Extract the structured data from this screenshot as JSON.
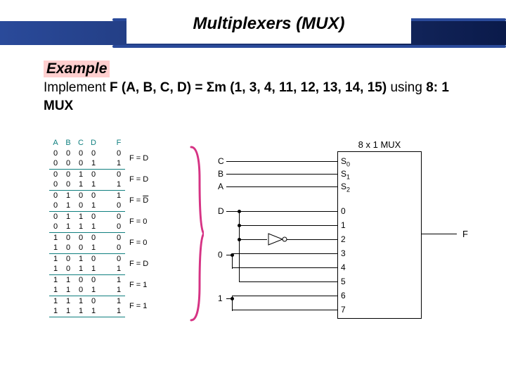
{
  "title": "Multiplexers (MUX)",
  "example_label": "Example",
  "statement_prefix": "Implement ",
  "statement_func": "F (A, B, C, D) = Σm (1, 3, 4, 11, 12, 13, 14, 15)",
  "statement_using": " using ",
  "statement_mux": "8: 1 MUX",
  "tt_headers": [
    "A",
    "B",
    "C",
    "D",
    "F"
  ],
  "tt_rows": [
    [
      "0",
      "0",
      "0",
      "0",
      "0"
    ],
    [
      "0",
      "0",
      "0",
      "1",
      "1"
    ],
    [
      "0",
      "0",
      "1",
      "0",
      "0"
    ],
    [
      "0",
      "0",
      "1",
      "1",
      "1"
    ],
    [
      "0",
      "1",
      "0",
      "0",
      "1"
    ],
    [
      "0",
      "1",
      "0",
      "1",
      "0"
    ],
    [
      "0",
      "1",
      "1",
      "0",
      "0"
    ],
    [
      "0",
      "1",
      "1",
      "1",
      "0"
    ],
    [
      "1",
      "0",
      "0",
      "0",
      "0"
    ],
    [
      "1",
      "0",
      "0",
      "1",
      "0"
    ],
    [
      "1",
      "0",
      "1",
      "0",
      "0"
    ],
    [
      "1",
      "0",
      "1",
      "1",
      "1"
    ],
    [
      "1",
      "1",
      "0",
      "0",
      "1"
    ],
    [
      "1",
      "1",
      "0",
      "1",
      "1"
    ],
    [
      "1",
      "1",
      "1",
      "0",
      "1"
    ],
    [
      "1",
      "1",
      "1",
      "1",
      "1"
    ]
  ],
  "tt_pair_labels": [
    "F = D",
    "F = D",
    "F = D̄",
    "F = 0",
    "F = 0",
    "F = D",
    "F = 1",
    "F = 1"
  ],
  "mux_title": "8 x 1 MUX",
  "sel_inputs": [
    "C",
    "B",
    "A"
  ],
  "sel_pins": [
    "S",
    "S",
    "S"
  ],
  "sel_sub": [
    "0",
    "1",
    "2"
  ],
  "data_inputs_left": {
    "d": "D",
    "zero": "0",
    "one": "1"
  },
  "data_pins": [
    "0",
    "1",
    "2",
    "3",
    "4",
    "5",
    "6",
    "7"
  ],
  "out_label": "F",
  "chart_data": {
    "type": "table",
    "title": "Truth table for F(A,B,C,D) = Σm(1,3,4,11,12,13,14,15)",
    "columns": [
      "A",
      "B",
      "C",
      "D",
      "F"
    ],
    "rows": [
      [
        0,
        0,
        0,
        0,
        0
      ],
      [
        0,
        0,
        0,
        1,
        1
      ],
      [
        0,
        0,
        1,
        0,
        0
      ],
      [
        0,
        0,
        1,
        1,
        1
      ],
      [
        0,
        1,
        0,
        0,
        1
      ],
      [
        0,
        1,
        0,
        1,
        0
      ],
      [
        0,
        1,
        1,
        0,
        0
      ],
      [
        0,
        1,
        1,
        1,
        0
      ],
      [
        1,
        0,
        0,
        0,
        0
      ],
      [
        1,
        0,
        0,
        1,
        0
      ],
      [
        1,
        0,
        1,
        0,
        0
      ],
      [
        1,
        0,
        1,
        1,
        1
      ],
      [
        1,
        1,
        0,
        0,
        1
      ],
      [
        1,
        1,
        0,
        1,
        1
      ],
      [
        1,
        1,
        1,
        0,
        1
      ],
      [
        1,
        1,
        1,
        1,
        1
      ]
    ],
    "mux_mapping": {
      "select_lines": [
        "A",
        "B",
        "C"
      ],
      "data_inputs": [
        "D",
        "D",
        "D̄",
        "0",
        "0",
        "D",
        "1",
        "1"
      ],
      "output": "F"
    }
  }
}
